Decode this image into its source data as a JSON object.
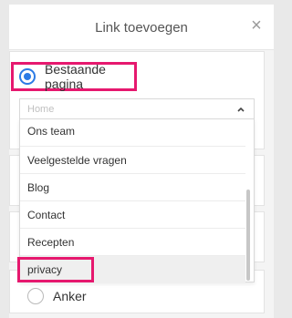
{
  "dialog": {
    "title": "Link toevoegen",
    "close_symbol": "×"
  },
  "link_types": {
    "existing_page": {
      "label": "Bestaande pagina",
      "checked": true
    },
    "anchor": {
      "label": "Anker",
      "checked": false
    }
  },
  "page_select": {
    "selected_value": "Home",
    "options": [
      {
        "label": "Ons team"
      },
      {
        "label": "Veelgestelde vragen"
      },
      {
        "label": "Blog"
      },
      {
        "label": "Contact"
      },
      {
        "label": "Recepten"
      },
      {
        "label": "privacy"
      }
    ]
  },
  "colors": {
    "highlight": "#e6186e",
    "radio_accent": "#2c7be5"
  },
  "icons": {
    "close": "close-icon",
    "chevron": "chevron-up-icon"
  }
}
